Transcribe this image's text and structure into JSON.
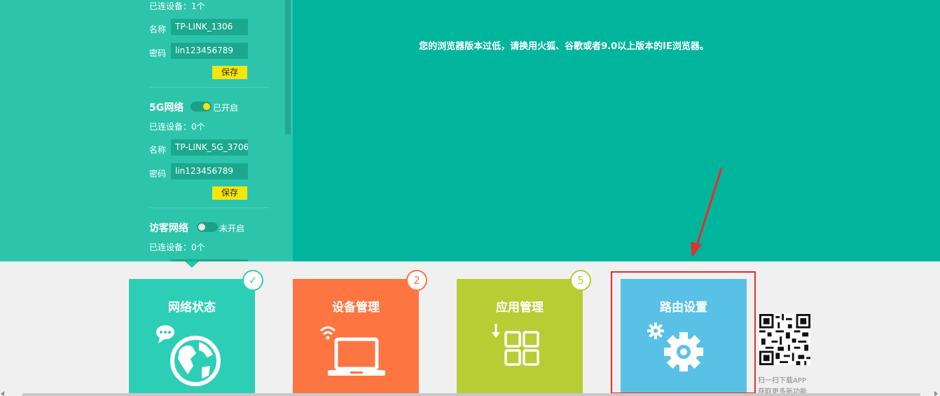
{
  "sidebar": {
    "wifi24": {
      "connected": "已连设备：1个",
      "name_label": "名称",
      "name_value": "TP-LINK_1306",
      "password_label": "密码",
      "password_value": "lin123456789",
      "save_label": "保存"
    },
    "wifi5g": {
      "title": "5G网络",
      "toggle_label": "已开启",
      "connected": "已连设备：0个",
      "name_label": "名称",
      "name_value": "TP-LINK_5G_3706",
      "password_label": "密码",
      "password_value": "lin123456789",
      "save_label": "保存"
    },
    "guest": {
      "title": "访客网络",
      "toggle_label": "未开启",
      "connected": "已连设备：0个"
    }
  },
  "main": {
    "browser_warning": "您的浏览器版本过低，请换用火狐、谷歌或者9.0以上版本的IE浏览器。"
  },
  "tiles": {
    "network_status": {
      "title": "网络状态",
      "badge": "✓",
      "color": "#2ccfb6"
    },
    "device_management": {
      "title": "设备管理",
      "badge": "2",
      "color": "#fd7541"
    },
    "app_management": {
      "title": "应用管理",
      "badge": "5",
      "color": "#b7cd34"
    },
    "router_settings": {
      "title": "路由设置",
      "color": "#5ac1e6"
    }
  },
  "qr": {
    "line1": "扫一扫下载APP",
    "line2": "获取更多新功能"
  },
  "colors": {
    "top_bg": "#00b59c",
    "sidebar_bg": "#2dc4ac",
    "save_button": "#f5e50b",
    "highlight": "#e03030"
  }
}
